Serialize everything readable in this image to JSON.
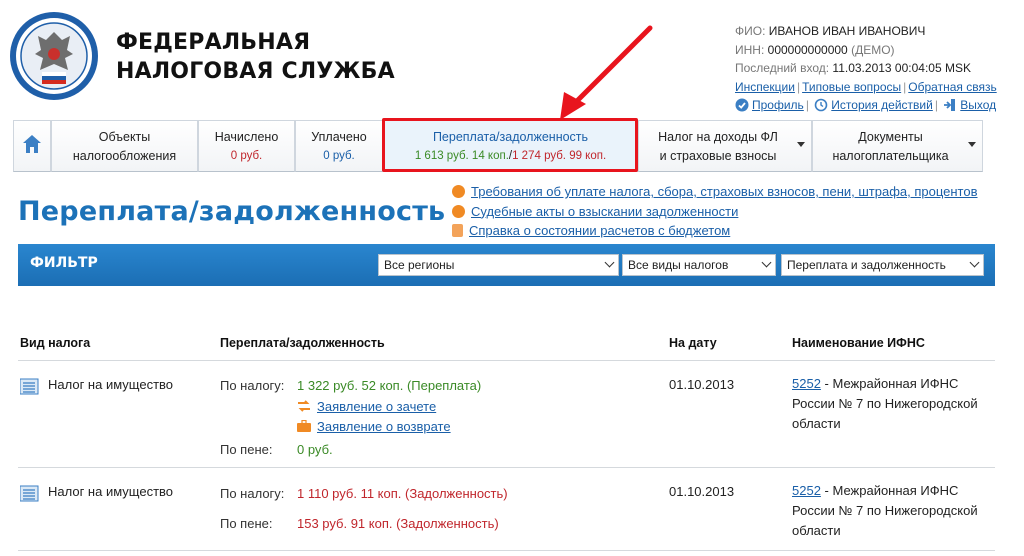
{
  "header": {
    "org_line1": "ФЕДЕРАЛЬНАЯ",
    "org_line2": "НАЛОГОВАЯ СЛУЖБА",
    "fio_label": "ФИО:",
    "fio_value": "ИВАНОВ ИВАН ИВАНОВИЧ",
    "inn_label": "ИНН:",
    "inn_value": "000000000000",
    "inn_note": "(ДЕМО)",
    "last_login_label": "Последний вход:",
    "last_login_value": "11.03.2013 00:04:05 MSK",
    "links": [
      "Инспекции",
      "Типовые вопросы",
      "Обратная связь"
    ],
    "profile_label": "Профиль",
    "history_label": "История действий",
    "logout_label": "Выход"
  },
  "tabs": [
    {
      "line1": "Объекты",
      "line2": "налогообложения"
    },
    {
      "line1": "Начислено",
      "line2": "0 руб."
    },
    {
      "line1": "Уплачено",
      "line2": "0 руб."
    },
    {
      "line1": "Переплата/задолженность",
      "line2a": "1 613 руб. 14 коп.",
      "line2sep": "/",
      "line2b": "1 274 руб. 99 коп."
    },
    {
      "line1": "Налог на доходы ФЛ",
      "line2": "и страховые взносы"
    },
    {
      "line1": "Документы",
      "line2": "налогоплательщика"
    }
  ],
  "page_title": "Переплата/задолженность",
  "quick_links": [
    "Требования об уплате налога, сбора, страховых взносов, пени, штрафа, процентов",
    "Судебные акты о взыскании задолженности",
    "Справка о состоянии расчетов с бюджетом"
  ],
  "filter": {
    "label": "ФИЛЬТР",
    "region": "Все регионы",
    "tax_type": "Все виды налогов",
    "mode": "Переплата и задолженность"
  },
  "table": {
    "headers": [
      "Вид налога",
      "Переплата/задолженность",
      "На дату",
      "Наименование ИФНС"
    ],
    "rows": [
      {
        "tax": "Налог на имущество",
        "tax_label": "По налогу:",
        "tax_value": "1 322 руб. 52 коп. (Переплата)",
        "action1": "Заявление о зачете",
        "action2": "Заявление о возврате",
        "penalty_label": "По пене:",
        "penalty_value": "0 руб.",
        "date": "01.10.2013",
        "ifns_code": "5252",
        "ifns_name": " - Межрайонная ИФНС России № 7 по Нижегородской области"
      },
      {
        "tax": "Налог на имущество",
        "tax_label": "По налогу:",
        "tax_value": "1 110 руб. 11 коп. (Задолженность)",
        "penalty_label": "По пене:",
        "penalty_value": "153 руб. 91 коп. (Задолженность)",
        "date": "01.10.2013",
        "ifns_code": "5252",
        "ifns_name": " - Межрайонная ИФНС России № 7 по Нижегородской области"
      }
    ]
  },
  "colors": {
    "accent": "#1c72b8",
    "highlight": "#e8141d",
    "overpayment": "#3a8a26",
    "debt": "#c0262c"
  }
}
